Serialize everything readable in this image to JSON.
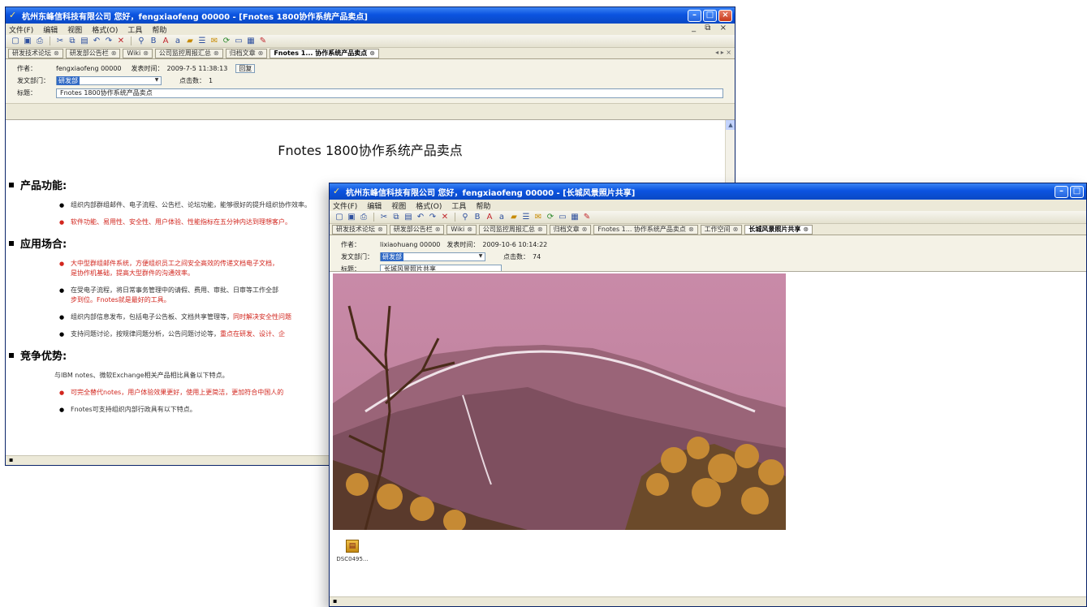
{
  "colors": {
    "titlebar": "#0b54e0",
    "accent_red": "#d2261e",
    "chrome": "#ece9d8"
  },
  "menu": {
    "file": "文件(F)",
    "edit": "编辑",
    "view": "视图",
    "format": "格式(O)",
    "tools": "工具",
    "help": "帮助",
    "mdi_controls": "_ ⧉ ×"
  },
  "window1": {
    "title": "杭州东峰信科技有限公司 您好，fengxiaofeng 00000 - [Fnotes 1800协作系统产品卖点]",
    "tabs": [
      {
        "label": "研发技术论坛"
      },
      {
        "label": "研发部公告栏"
      },
      {
        "label": "Wiki"
      },
      {
        "label": "公司监控周报汇总"
      },
      {
        "label": "归档文章"
      },
      {
        "label": "Fnotes 1... 协作系统产品卖点",
        "active": true
      }
    ],
    "header": {
      "author_label": "作者：",
      "author_value": "fengxiaofeng 00000",
      "time_label": "发表时间：",
      "time_value": "2009-7-5 11:38:13",
      "reply_label": "回复",
      "dept_label": "发文部门：",
      "dept_value": "研发部",
      "clicks_label": "点击数：",
      "clicks_value": "1",
      "subject_label": "标题：",
      "subject_value": "Fnotes 1800协作系统产品卖点"
    },
    "doc": {
      "title": "Fnotes 1800协作系统产品卖点",
      "sections": [
        {
          "heading": "产品功能:",
          "items": [
            {
              "text": "组织内部群组邮件、电子流程、公告栏、论坛功能，能够很好的提升组织协作效率。",
              "red": false
            },
            {
              "text": "软件功能、易用性、安全性、用户体验、性能指标在五分钟内达到理想客户。",
              "red": true
            }
          ]
        },
        {
          "heading": "应用场合:",
          "items": [
            {
              "text": "大中型群组邮件系统，方便组织员工之间安全高效的传递文档电子文档，",
              "red_tail": "是协作机基础，提高大型群件的沟通效率。",
              "red": true
            },
            {
              "text": "在受电子流程，将日常事务管理中的请假、费用、审批、日审等工作全部",
              "red_tail": "步到位。Fnotes就是最好的工具。",
              "red": false
            },
            {
              "text": "组织内部信息发布，包括电子公告板、文档共享管理等，",
              "red_tail": "同时解决安全性问题",
              "red": false
            },
            {
              "text": "支持问题讨论，按规律问题分析，公告问题讨论等，",
              "red_tail": "重点在研发、设计、企",
              "red": false
            }
          ]
        },
        {
          "heading": "竞争优势:",
          "intro": "与IBM notes、微软Exchange相关产品相比具备以下特点。",
          "items": [
            {
              "text": "可完全替代notes，用户体验效果更好，使用上更简洁，更加符合中国人的",
              "red": true
            },
            {
              "text": "Fnotes可支持组织内部行政具有以下特点。",
              "red": false
            }
          ]
        }
      ]
    }
  },
  "window2": {
    "title": "杭州东峰信科技有限公司 您好，fengxiaofeng 00000 - [长城风景照片共享]",
    "tabs": [
      {
        "label": "研发技术论坛"
      },
      {
        "label": "研发部公告栏"
      },
      {
        "label": "Wiki"
      },
      {
        "label": "公司监控周报汇总"
      },
      {
        "label": "归档文章"
      },
      {
        "label": "Fnotes 1... 协作系统产品卖点"
      },
      {
        "label": "工作空间"
      },
      {
        "label": "长城风景照片共享",
        "active": true
      }
    ],
    "header": {
      "author_label": "作者：",
      "author_value": "lixiaohuang 00000",
      "time_label": "发表时间：",
      "time_value": "2009-10-6 10:14:22",
      "dept_label": "发文部门：",
      "dept_value": "研发部",
      "clicks_label": "点击数：",
      "clicks_value": "74",
      "subject_label": "标题：",
      "subject_value": "长城风景照片共享"
    },
    "attachment": {
      "name": "DSC0495..."
    }
  }
}
